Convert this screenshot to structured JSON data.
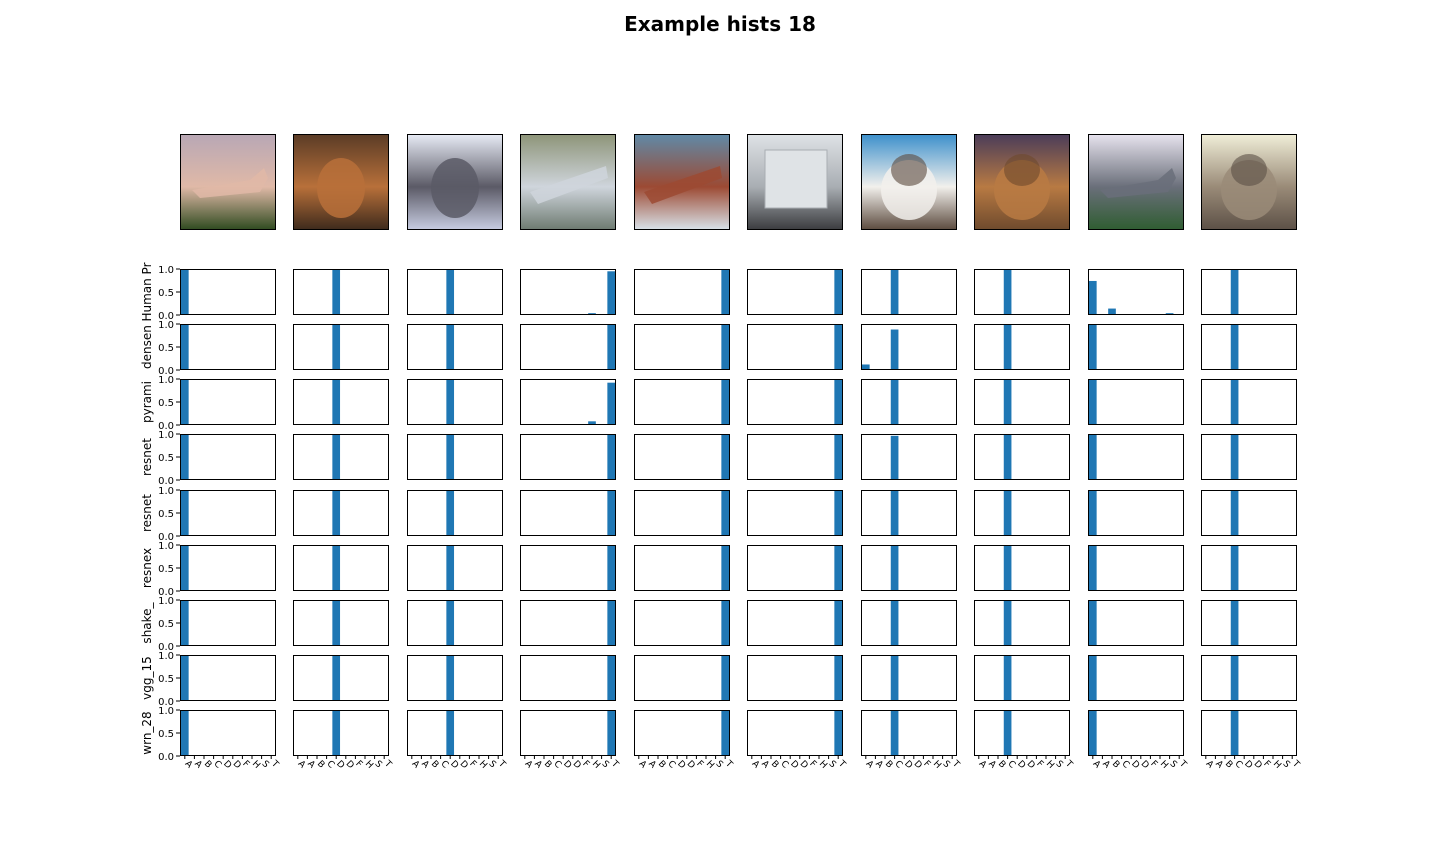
{
  "title": "Example hists 18",
  "chart_data": {
    "type": "bar",
    "title": "Example hists 18",
    "categories": [
      "A",
      "A",
      "B",
      "C",
      "D",
      "D",
      "F",
      "H",
      "S",
      "T"
    ],
    "rows": [
      "Human Pr",
      "densen",
      "pyrami",
      "resnet",
      "resnet",
      "resnex",
      "shake_",
      "vgg_15",
      "wrn_28"
    ],
    "ylim": [
      0,
      1.0
    ],
    "yticks": [
      "0.0",
      "0.5",
      "1.0"
    ],
    "bar_color": "#1f77b4",
    "thumbnails": [
      {
        "subject": "airplane",
        "colors": [
          "#b8a7b5",
          "#e0b9a7",
          "#2e4a1f"
        ]
      },
      {
        "subject": "deer",
        "colors": [
          "#5a3b26",
          "#b8703a",
          "#3d2a1c"
        ]
      },
      {
        "subject": "deer",
        "colors": [
          "#e8ecf6",
          "#5b5a66",
          "#c8cde2"
        ]
      },
      {
        "subject": "ship",
        "colors": [
          "#8d9478",
          "#cfd5dc",
          "#6d7a70"
        ]
      },
      {
        "subject": "ship",
        "colors": [
          "#5f8aa8",
          "#9c4a33",
          "#d9e3ea"
        ]
      },
      {
        "subject": "truck",
        "colors": [
          "#dfe3e6",
          "#a9aeb3",
          "#3a3b3e"
        ]
      },
      {
        "subject": "cat",
        "colors": [
          "#3b8fcb",
          "#f2f0ec",
          "#5b4a3e"
        ]
      },
      {
        "subject": "cat",
        "colors": [
          "#4a3c59",
          "#b87a43",
          "#6e4a2d"
        ]
      },
      {
        "subject": "airplane",
        "colors": [
          "#e8e4ef",
          "#6a6f7a",
          "#2f5d31"
        ]
      },
      {
        "subject": "cat",
        "colors": [
          "#f1efd9",
          "#9a8b78",
          "#5c5046"
        ]
      }
    ],
    "hists": [
      [
        [
          1.0,
          0,
          0,
          0,
          0,
          0,
          0,
          0,
          0.02,
          0
        ],
        [
          1.0,
          0,
          0,
          0,
          0,
          0,
          0,
          0,
          0,
          0
        ],
        [
          1.0,
          0,
          0,
          0,
          0,
          0,
          0,
          0,
          0,
          0
        ],
        [
          1.0,
          0,
          0,
          0,
          0,
          0,
          0,
          0,
          0,
          0
        ],
        [
          1.0,
          0,
          0,
          0,
          0,
          0,
          0,
          0,
          0,
          0
        ],
        [
          1.0,
          0,
          0,
          0,
          0,
          0,
          0,
          0,
          0,
          0
        ],
        [
          1.0,
          0,
          0,
          0,
          0,
          0,
          0,
          0,
          0,
          0
        ],
        [
          1.0,
          0,
          0,
          0,
          0,
          0,
          0,
          0,
          0,
          0
        ],
        [
          1.0,
          0,
          0,
          0,
          0,
          0,
          0,
          0,
          0,
          0
        ]
      ],
      [
        [
          0,
          0,
          0,
          0,
          1.0,
          0,
          0,
          0,
          0.02,
          0
        ],
        [
          0,
          0,
          0,
          0,
          1.0,
          0,
          0,
          0,
          0,
          0
        ],
        [
          0,
          0,
          0,
          0,
          1.0,
          0,
          0,
          0,
          0,
          0
        ],
        [
          0,
          0,
          0,
          0,
          1.0,
          0,
          0,
          0,
          0,
          0
        ],
        [
          0,
          0,
          0,
          0,
          1.0,
          0,
          0,
          0,
          0,
          0
        ],
        [
          0,
          0,
          0,
          0,
          1.0,
          0,
          0,
          0,
          0,
          0
        ],
        [
          0,
          0,
          0,
          0,
          1.0,
          0,
          0,
          0,
          0,
          0
        ],
        [
          0,
          0,
          0,
          0,
          1.0,
          0,
          0,
          0,
          0,
          0
        ],
        [
          0,
          0,
          0,
          0,
          1.0,
          0,
          0,
          0,
          0,
          0
        ]
      ],
      [
        [
          0,
          0,
          0,
          0,
          1.0,
          0,
          0,
          0.02,
          0,
          0
        ],
        [
          0,
          0,
          0,
          0,
          1.0,
          0,
          0,
          0,
          0,
          0
        ],
        [
          0,
          0,
          0,
          0,
          1.0,
          0,
          0,
          0,
          0,
          0
        ],
        [
          0,
          0,
          0,
          0,
          1.0,
          0,
          0,
          0,
          0,
          0
        ],
        [
          0,
          0,
          0,
          0,
          1.0,
          0,
          0,
          0,
          0,
          0
        ],
        [
          0,
          0,
          0,
          0,
          1.0,
          0,
          0,
          0,
          0,
          0
        ],
        [
          0,
          0,
          0,
          0,
          1.0,
          0,
          0,
          0,
          0,
          0
        ],
        [
          0,
          0,
          0,
          0,
          1.0,
          0,
          0,
          0,
          0,
          0
        ],
        [
          0,
          0,
          0,
          0,
          1.0,
          0,
          0,
          0,
          0,
          0
        ]
      ],
      [
        [
          0,
          0,
          0,
          0,
          0,
          0,
          0,
          0.04,
          0,
          0.95
        ],
        [
          0,
          0,
          0,
          0,
          0,
          0,
          0,
          0,
          0,
          1.0
        ],
        [
          0,
          0,
          0,
          0,
          0,
          0,
          0,
          0.08,
          0,
          0.92
        ],
        [
          0,
          0,
          0,
          0,
          0,
          0,
          0,
          0,
          0,
          1.0
        ],
        [
          0,
          0,
          0,
          0,
          0,
          0,
          0,
          0,
          0,
          1.0
        ],
        [
          0,
          0,
          0,
          0,
          0,
          0,
          0,
          0,
          0,
          1.0
        ],
        [
          0,
          0,
          0,
          0,
          0,
          0,
          0,
          0,
          0,
          1.0
        ],
        [
          0,
          0,
          0,
          0,
          0,
          0,
          0,
          0,
          0,
          1.0
        ],
        [
          0,
          0,
          0,
          0,
          0,
          0,
          0,
          0,
          0,
          1.0
        ]
      ],
      [
        [
          0,
          0,
          0,
          0,
          0,
          0,
          0,
          0,
          0,
          1.0
        ],
        [
          0,
          0,
          0,
          0,
          0,
          0,
          0,
          0,
          0,
          1.0
        ],
        [
          0,
          0,
          0,
          0,
          0,
          0,
          0,
          0,
          0,
          1.0
        ],
        [
          0,
          0,
          0,
          0,
          0,
          0,
          0,
          0,
          0,
          1.0
        ],
        [
          0,
          0,
          0,
          0,
          0,
          0,
          0,
          0,
          0,
          1.0
        ],
        [
          0,
          0,
          0,
          0,
          0,
          0,
          0,
          0,
          0,
          1.0
        ],
        [
          0,
          0,
          0,
          0,
          0,
          0,
          0,
          0,
          0,
          1.0
        ],
        [
          0,
          0,
          0,
          0,
          0,
          0,
          0,
          0,
          0,
          1.0
        ],
        [
          0,
          0,
          0,
          0,
          0,
          0,
          0,
          0,
          0,
          1.0
        ]
      ],
      [
        [
          0,
          0,
          0,
          0,
          0,
          0,
          0,
          0,
          0,
          1.0
        ],
        [
          0,
          0,
          0,
          0,
          0,
          0,
          0,
          0,
          0,
          1.0
        ],
        [
          0,
          0,
          0,
          0,
          0,
          0,
          0,
          0,
          0,
          1.0
        ],
        [
          0,
          0,
          0,
          0,
          0,
          0,
          0,
          0,
          0,
          1.0
        ],
        [
          0,
          0,
          0,
          0,
          0,
          0,
          0,
          0,
          0,
          1.0
        ],
        [
          0,
          0,
          0,
          0,
          0,
          0,
          0,
          0,
          0,
          1.0
        ],
        [
          0,
          0,
          0,
          0,
          0,
          0,
          0,
          0,
          0,
          1.0
        ],
        [
          0,
          0,
          0,
          0,
          0,
          0,
          0,
          0,
          0,
          1.0
        ],
        [
          0,
          0,
          0,
          0,
          0,
          0,
          0,
          0,
          0,
          1.0
        ]
      ],
      [
        [
          0,
          0,
          0,
          1.0,
          0,
          0.02,
          0,
          0,
          0,
          0
        ],
        [
          0.12,
          0,
          0,
          0.88,
          0,
          0,
          0,
          0,
          0,
          0
        ],
        [
          0,
          0,
          0,
          1.0,
          0,
          0,
          0,
          0,
          0,
          0
        ],
        [
          0,
          0,
          0,
          0.96,
          0,
          0,
          0,
          0,
          0,
          0
        ],
        [
          0,
          0,
          0,
          1.0,
          0,
          0,
          0,
          0,
          0,
          0
        ],
        [
          0,
          0,
          0,
          1.0,
          0,
          0,
          0,
          0,
          0,
          0
        ],
        [
          0,
          0,
          0,
          1.0,
          0,
          0.02,
          0,
          0,
          0,
          0
        ],
        [
          0,
          0,
          0,
          1.0,
          0,
          0,
          0,
          0,
          0,
          0
        ],
        [
          0,
          0,
          0,
          1.0,
          0,
          0,
          0,
          0,
          0,
          0
        ]
      ],
      [
        [
          0,
          0,
          0,
          1.0,
          0,
          0,
          0,
          0,
          0,
          0
        ],
        [
          0,
          0,
          0,
          1.0,
          0,
          0,
          0,
          0,
          0,
          0
        ],
        [
          0,
          0,
          0,
          1.0,
          0,
          0,
          0,
          0,
          0,
          0
        ],
        [
          0,
          0,
          0,
          1.0,
          0,
          0,
          0,
          0,
          0,
          0
        ],
        [
          0,
          0,
          0,
          1.0,
          0,
          0,
          0,
          0,
          0,
          0
        ],
        [
          0,
          0,
          0,
          1.0,
          0,
          0,
          0,
          0,
          0,
          0
        ],
        [
          0,
          0,
          0,
          1.0,
          0,
          0,
          0,
          0,
          0,
          0
        ],
        [
          0,
          0,
          0,
          1.0,
          0,
          0,
          0,
          0,
          0,
          0
        ],
        [
          0,
          0,
          0,
          1.0,
          0,
          0,
          0,
          0,
          0,
          0
        ]
      ],
      [
        [
          0.74,
          0,
          0.14,
          0,
          0.02,
          0,
          0.02,
          0,
          0.04,
          0.02
        ],
        [
          1.0,
          0,
          0,
          0,
          0,
          0,
          0,
          0,
          0,
          0
        ],
        [
          1.0,
          0,
          0,
          0,
          0,
          0,
          0,
          0,
          0,
          0
        ],
        [
          1.0,
          0,
          0,
          0,
          0,
          0,
          0,
          0,
          0,
          0
        ],
        [
          1.0,
          0,
          0,
          0,
          0,
          0,
          0,
          0,
          0,
          0
        ],
        [
          1.0,
          0,
          0,
          0,
          0,
          0,
          0,
          0,
          0.02,
          0
        ],
        [
          1.0,
          0,
          0,
          0,
          0,
          0,
          0,
          0,
          0,
          0
        ],
        [
          1.0,
          0,
          0,
          0,
          0,
          0,
          0,
          0,
          0,
          0
        ],
        [
          1.0,
          0,
          0,
          0,
          0,
          0,
          0,
          0,
          0,
          0
        ]
      ],
      [
        [
          0,
          0,
          0,
          1.0,
          0,
          0,
          0,
          0,
          0,
          0
        ],
        [
          0,
          0,
          0,
          1.0,
          0,
          0,
          0,
          0,
          0,
          0
        ],
        [
          0,
          0,
          0,
          1.0,
          0,
          0,
          0,
          0,
          0,
          0
        ],
        [
          0,
          0,
          0,
          1.0,
          0,
          0,
          0,
          0,
          0,
          0
        ],
        [
          0,
          0,
          0,
          1.0,
          0,
          0,
          0,
          0,
          0,
          0
        ],
        [
          0,
          0,
          0,
          1.0,
          0,
          0,
          0,
          0,
          0,
          0
        ],
        [
          0,
          0,
          0,
          1.0,
          0,
          0,
          0,
          0,
          0,
          0
        ],
        [
          0,
          0,
          0,
          1.0,
          0,
          0,
          0,
          0,
          0,
          0
        ],
        [
          0,
          0,
          0,
          1.0,
          0,
          0,
          0,
          0,
          0,
          0
        ]
      ]
    ]
  }
}
